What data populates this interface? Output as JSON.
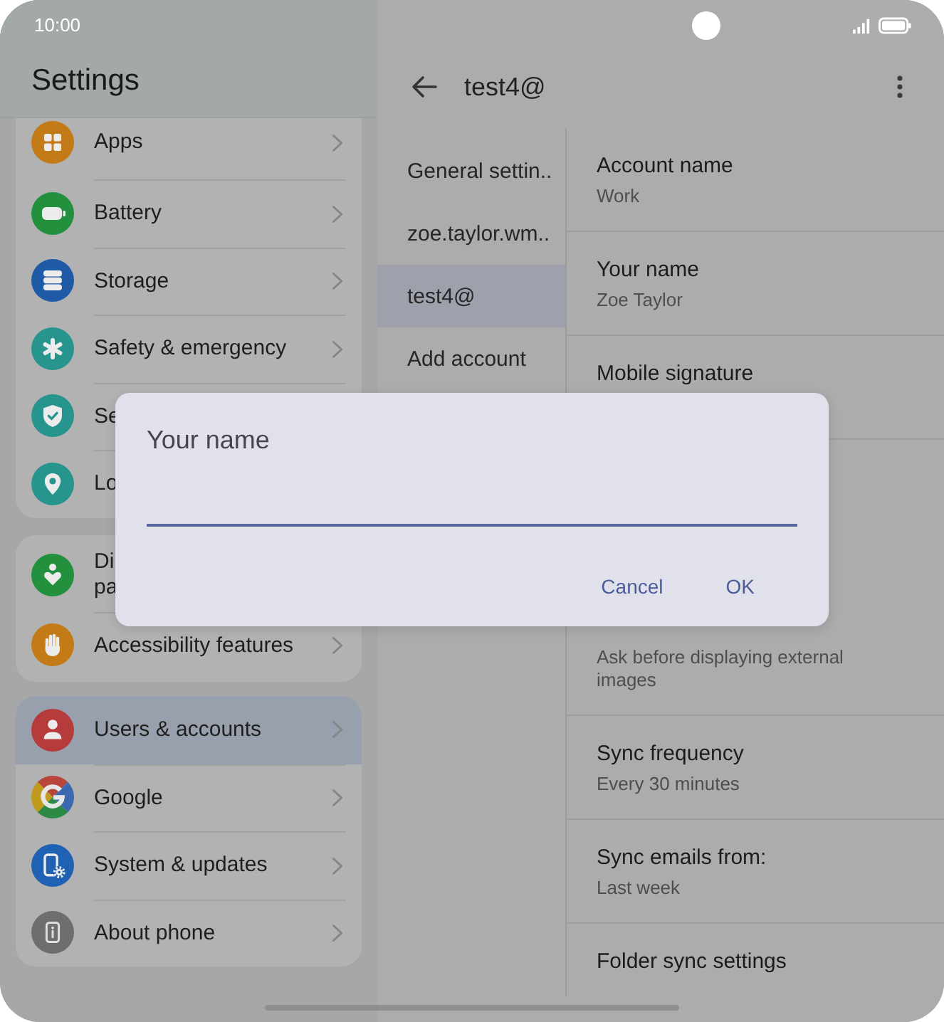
{
  "status_bar": {
    "time": "10:00"
  },
  "settings_panel": {
    "title": "Settings",
    "groups": [
      {
        "items": [
          {
            "label": "Apps",
            "selected": false,
            "chevron": true
          },
          {
            "label": "Battery",
            "selected": false,
            "chevron": true
          },
          {
            "label": "Storage",
            "selected": false,
            "chevron": true
          },
          {
            "label": "Safety & emergency",
            "selected": false,
            "chevron": true
          },
          {
            "label": "Se",
            "selected": false
          },
          {
            "label": "Lo",
            "selected": false
          }
        ]
      },
      {
        "items": [
          {
            "label": "Di\npa",
            "selected": false
          },
          {
            "label": "Accessibility features",
            "selected": false,
            "chevron": true
          }
        ]
      },
      {
        "items": [
          {
            "label": "Users & accounts",
            "selected": true,
            "chevron": true
          },
          {
            "label": "Google",
            "selected": false,
            "chevron": true
          },
          {
            "label": "System & updates",
            "selected": false,
            "chevron": true
          },
          {
            "label": "About phone",
            "selected": false,
            "chevron": true
          }
        ]
      }
    ]
  },
  "account_panel": {
    "title": "test4@",
    "accounts": [
      {
        "label": "General settin..",
        "selected": false
      },
      {
        "label": "zoe.taylor.wm..",
        "selected": false
      },
      {
        "label": "test4@",
        "selected": true
      },
      {
        "label": "Add account",
        "selected": false
      }
    ],
    "settings": [
      {
        "title": "Account name",
        "value": "Work"
      },
      {
        "title": "Your name",
        "value": "Zoe Taylor"
      },
      {
        "title": "Mobile signature"
      },
      {
        "value": "Ask before displaying external images"
      },
      {
        "title": "Sync frequency",
        "value": "Every 30 minutes"
      },
      {
        "title": "Sync emails from:",
        "value": "Last week"
      },
      {
        "title": "Folder sync settings"
      }
    ]
  },
  "dialog": {
    "title": "Your name",
    "buttons": [
      "Cancel",
      "OK"
    ]
  }
}
